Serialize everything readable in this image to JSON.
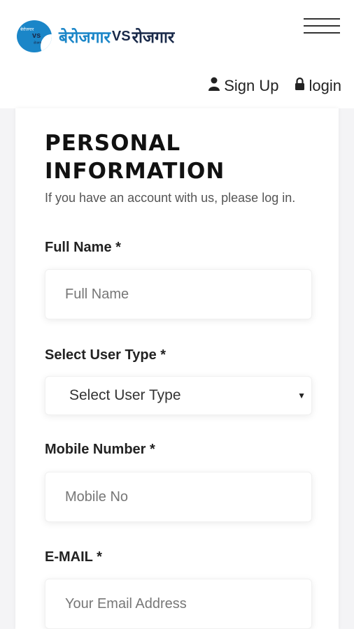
{
  "header": {
    "logo": {
      "circle_top": "बेरोजगार",
      "circle_vs": "vs",
      "circle_bottom": "रोजगार",
      "word1": "बेरोजगार",
      "vs": "VS",
      "word2": "रोजगार"
    },
    "auth": {
      "signup_label": "Sign Up",
      "login_label": "login"
    }
  },
  "form": {
    "title": "PERSONAL INFORMATION",
    "subtitle": "If you have an account with us, please log in.",
    "full_name": {
      "label": "Full Name *",
      "placeholder": "Full Name"
    },
    "user_type": {
      "label": "Select User Type *",
      "selected": "Select User Type"
    },
    "mobile": {
      "label": "Mobile Number *",
      "placeholder": "Mobile No"
    },
    "email": {
      "label": "E-MAIL *",
      "placeholder": "Your Email Address"
    }
  },
  "colors": {
    "brand_blue": "#1b86c8",
    "brand_dark": "#1a2a4a",
    "page_bg": "#f4f4f6"
  }
}
